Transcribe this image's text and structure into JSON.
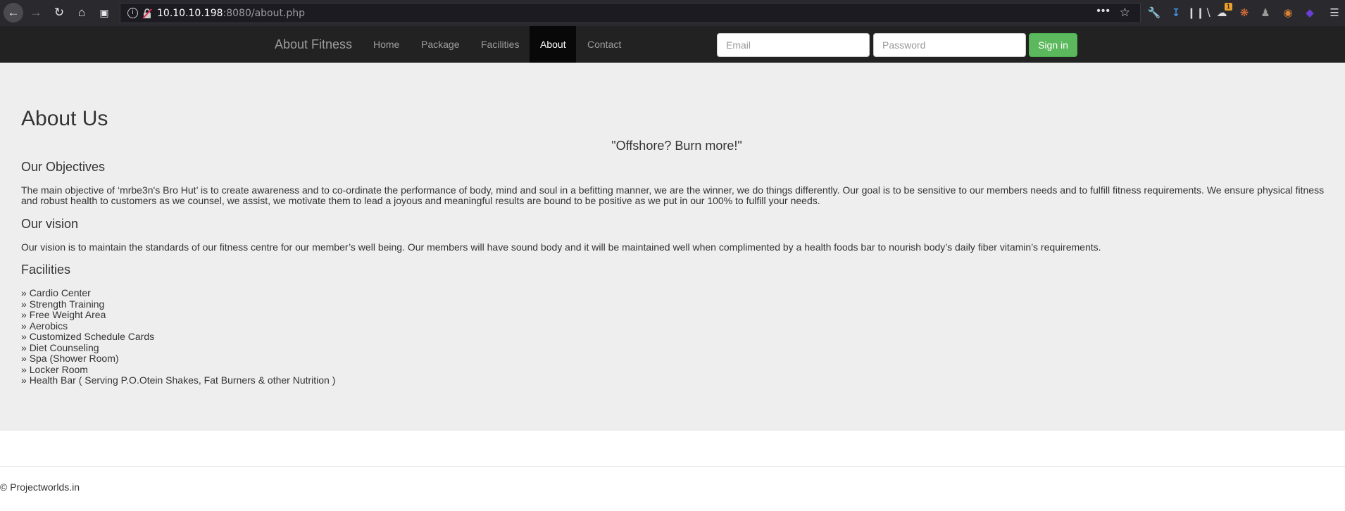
{
  "browser": {
    "url_host": "10.10.10.198",
    "url_path": ":8080/about.php",
    "downloads_badge": "1"
  },
  "navbar": {
    "brand": "About Fitness",
    "links": [
      "Home",
      "Package",
      "Facilities",
      "About",
      "Contact"
    ],
    "active": "About",
    "email_placeholder": "Email",
    "password_placeholder": "Password",
    "signin_label": "Sign in",
    "signin_color": "#5cb85c"
  },
  "content": {
    "title": "About Us",
    "tagline": "\"Offshore? Burn more!\"",
    "objectives_heading": "Our Objectives",
    "objectives_text": "The main objective of ‘mrbe3n's Bro Hut’ is to create awareness and to co-ordinate the performance of body, mind and soul in a befitting manner, we are the winner, we do things differently. Our goal is to be sensitive to our members needs and to fulfill fitness requirements. We ensure physical fitness and robust health to customers as we counsel, we assist, we motivate them to lead a joyous and meaningful results are bound to be positive as we put in our 100% to fulfill your needs.",
    "vision_heading": "Our vision",
    "vision_text": "Our vision is to maintain the standards of our fitness centre for our member’s well being. Our members will have sound body and it will be maintained well when complimented by a health foods bar to nourish body’s daily fiber vitamin’s requirements.",
    "facilities_heading": "Facilities",
    "facilities": [
      "Cardio Center",
      "Strength Training",
      "Free Weight Area",
      "Aerobics",
      "Customized Schedule Cards",
      "Diet Counseling",
      "Spa (Shower Room)",
      "Locker Room",
      "Health Bar ( Serving P.O.Otein Shakes, Fat Burners & other Nutrition )"
    ]
  },
  "footer": {
    "text": "© Projectworlds.in"
  }
}
